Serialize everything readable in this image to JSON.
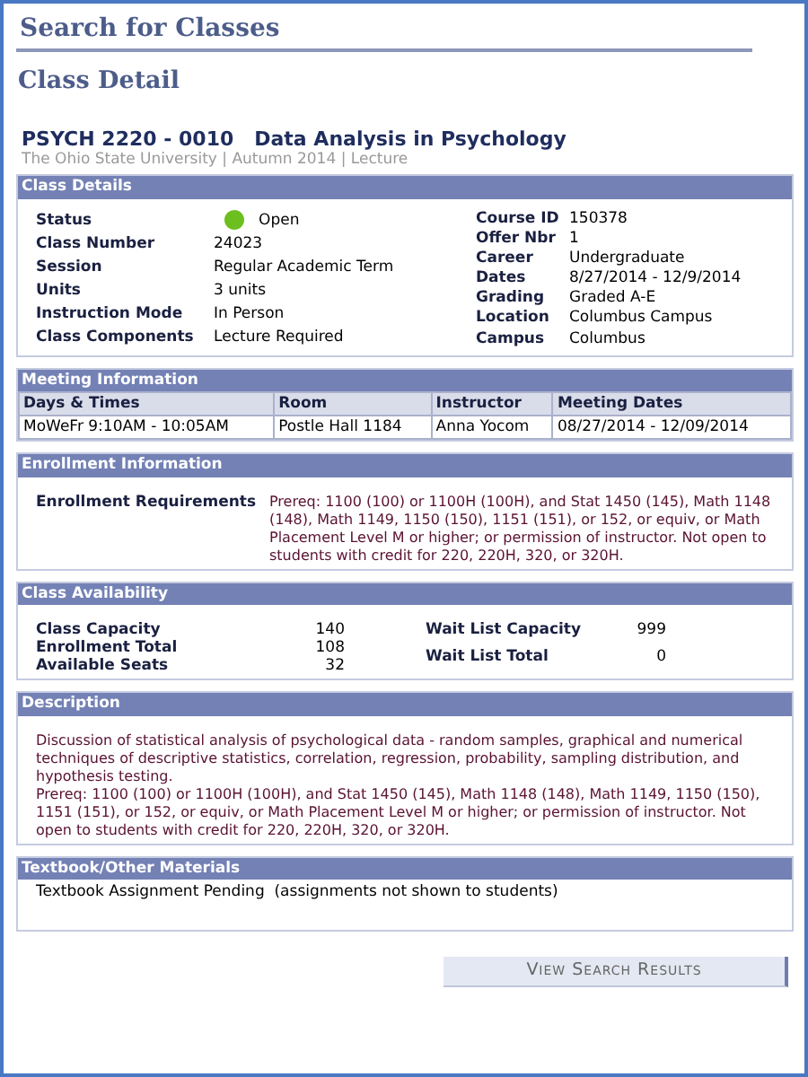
{
  "page_title": "Search for Classes",
  "subtitle": "Class Detail",
  "class_title": "PSYCH 2220 - 0010   Data Analysis in Psychology",
  "class_meta": "The Ohio State University | Autumn 2014 | Lecture",
  "class_details": {
    "heading": "Class Details",
    "left": [
      {
        "label": "Status",
        "value": "Open",
        "kind": "status"
      },
      {
        "label": "Class Number",
        "value": "24023",
        "kind": "text"
      },
      {
        "label": "Session",
        "value": "Regular Academic Term",
        "kind": "text"
      },
      {
        "label": "Units",
        "value": "3 units",
        "kind": "text"
      },
      {
        "label": "Instruction Mode",
        "value": "In Person",
        "kind": "text"
      },
      {
        "label": "Class Components",
        "value": "Lecture Required",
        "kind": "text"
      }
    ],
    "right": [
      {
        "label": "Course ID",
        "value": "150378"
      },
      {
        "label": "Offer Nbr",
        "value": "1"
      },
      {
        "label": "Career",
        "value": "Undergraduate"
      },
      {
        "label": "Dates",
        "value": "8/27/2014 - 12/9/2014"
      },
      {
        "label": "Grading",
        "value": "Graded A-E"
      },
      {
        "label": "Location",
        "value": "Columbus Campus"
      },
      {
        "label": "Campus",
        "value": "Columbus"
      }
    ]
  },
  "meeting": {
    "heading": "Meeting Information",
    "columns": [
      "Days & Times",
      "Room",
      "Instructor",
      "Meeting Dates"
    ],
    "rows": [
      [
        "MoWeFr 9:10AM - 10:05AM",
        "Postle Hall 1184",
        "Anna Yocom",
        "08/27/2014 - 12/09/2014"
      ]
    ]
  },
  "enrollment": {
    "heading": "Enrollment Information",
    "label": "Enrollment Requirements",
    "value": "Prereq: 1100 (100) or 1100H (100H), and Stat 1450 (145), Math 1148 (148), Math 1149, 1150 (150), 1151 (151), or 152, or equiv, or Math Placement Level M or higher; or permission of instructor. Not open to students with credit for 220, 220H, 320, or 320H."
  },
  "availability": {
    "heading": "Class Availability",
    "left": [
      {
        "label": "Class Capacity",
        "value": "140"
      },
      {
        "label": "Enrollment Total",
        "value": "108"
      },
      {
        "label": "Available Seats",
        "value": "32"
      }
    ],
    "right": [
      {
        "label": "Wait List Capacity",
        "value": "999"
      },
      {
        "label": "Wait List Total",
        "value": "0"
      }
    ]
  },
  "description": {
    "heading": "Description",
    "paragraphs": [
      "Discussion of statistical analysis of psychological data - random samples, graphical and numerical techniques of descriptive statistics, correlation, regression, probability, sampling distribution, and hypothesis testing.",
      "Prereq: 1100 (100) or 1100H (100H), and Stat 1450 (145), Math 1148 (148), Math 1149, 1150 (150), 1151 (151), or 152, or equiv, or Math Placement Level M or higher; or permission of instructor. Not open to students with credit for 220, 220H, 320, or 320H."
    ]
  },
  "materials": {
    "heading": "Textbook/Other Materials",
    "text": "Textbook Assignment Pending  (assignments not shown to students)"
  },
  "button": "View Search Results"
}
